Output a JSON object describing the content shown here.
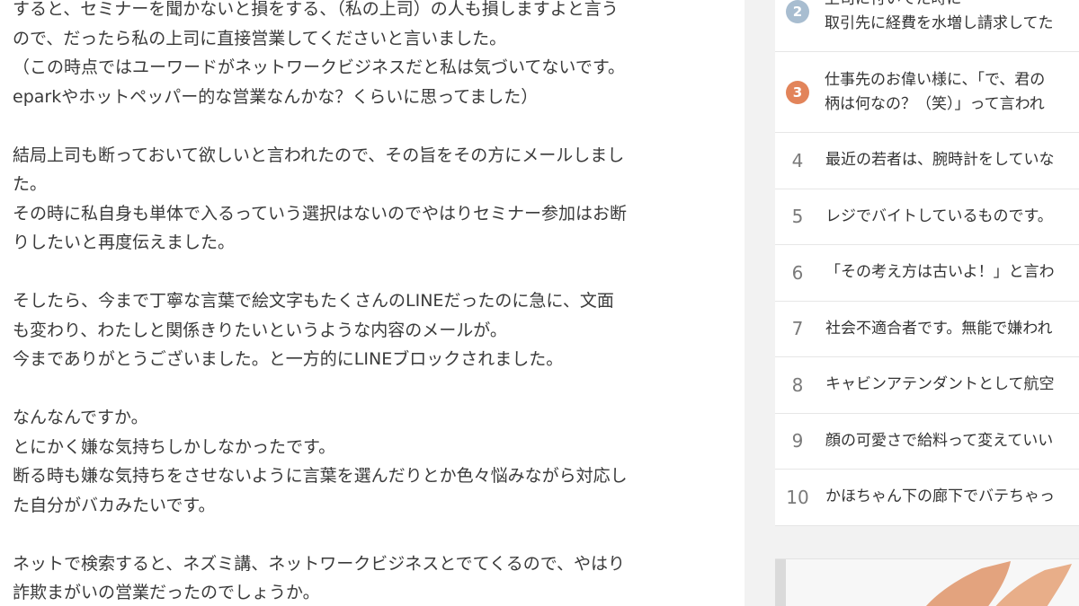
{
  "article": {
    "paragraphs": [
      [
        "すると、セミナーを聞かないと損をする、（私の上司）の人も損しますよと言う",
        "ので、だったら私の上司に直接営業してくださいと言いました。",
        "（この時点ではユーワードがネットワークビジネスだと私は気づいてないです。",
        "eparkやホットペッパー的な営業なんかな？くらいに思ってました）"
      ],
      [
        "結局上司も断っておいて欲しいと言われたので、その旨をその方にメールしまし",
        "た。",
        "その時に私自身も単体で入るっていう選択はないのでやはりセミナー参加はお断",
        "りしたいと再度伝えました。"
      ],
      [
        "そしたら、今まで丁寧な言葉で絵文字もたくさんのLINEだったのに急に、文面",
        "も変わり、わたしと関係きりたいというような内容のメールが。",
        "今までありがとうございました。と一方的にLINEブロックされました。"
      ],
      [
        "なんなんですか。",
        "とにかく嫌な気持ちしかしなかったです。",
        "断る時も嫌な気持ちをさせないように言葉を選んだりとか色々悩みながら対応し",
        "た自分がバカみたいです。"
      ],
      [
        "ネットで検索すると、ネズミ講、ネットワークビジネスとでてくるので、やはり",
        "詐欺まがいの営業だったのでしょうか。"
      ]
    ]
  },
  "sidebar": {
    "ranking": [
      {
        "rank": "2",
        "lines": [
          "上司に付いてた時に",
          "取引先に経費を水増し請求してた"
        ],
        "badge_color": "#a8bdd0"
      },
      {
        "rank": "3",
        "lines": [
          "仕事先のお偉い様に、「で、君の",
          "柄は何なの？（笑）」って言われ"
        ],
        "badge_color": "#e2845a"
      },
      {
        "rank": "4",
        "lines": [
          "最近の若者は、腕時計をしていな"
        ]
      },
      {
        "rank": "5",
        "lines": [
          "レジでバイトしているものです。"
        ]
      },
      {
        "rank": "6",
        "lines": [
          "「その考え方は古いよ！」と言わ"
        ]
      },
      {
        "rank": "7",
        "lines": [
          "社会不適合者です。無能で嫌われ"
        ]
      },
      {
        "rank": "8",
        "lines": [
          "キャビンアテンダントとして航空"
        ]
      },
      {
        "rank": "9",
        "lines": [
          "顔の可愛さで給料って変えていい"
        ]
      },
      {
        "rank": "10",
        "lines": [
          "かほちゃん下の廊下でバテちゃっ"
        ]
      }
    ]
  }
}
